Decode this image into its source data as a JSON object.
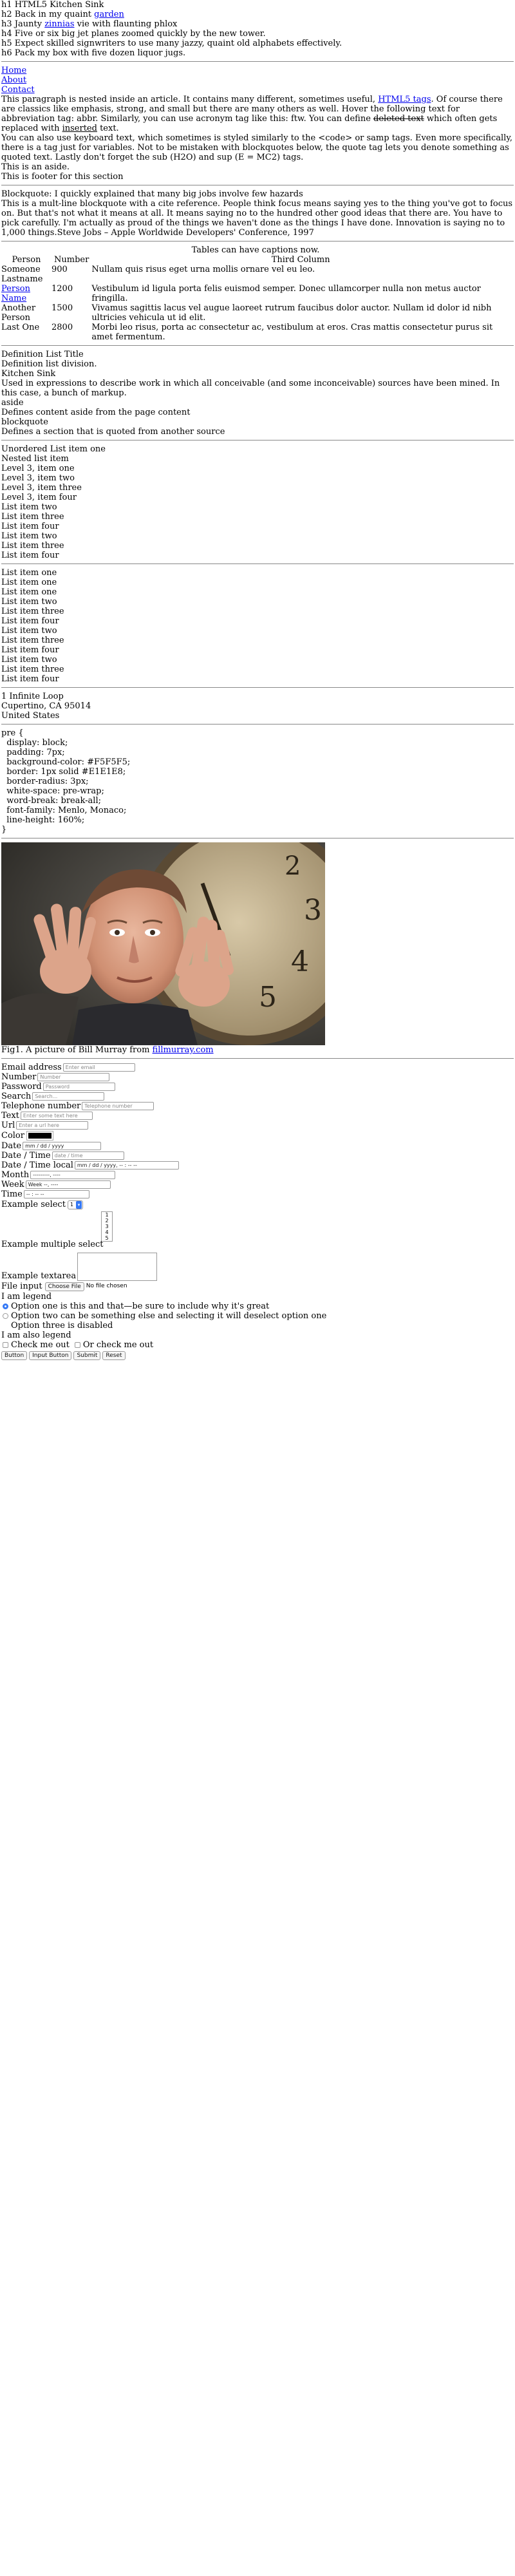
{
  "headings": {
    "h1": "h1 HTML5 Kitchen Sink",
    "h2_pre": "h2 Back in my quaint ",
    "h2_link": "garden",
    "h3_pre": "h3 Jaunty ",
    "h3_link": "zinnias",
    "h3_post": " vie with flaunting phlox",
    "h4": "h4 Five or six big jet planes zoomed quickly by the new tower.",
    "h5": "h5 Expect skilled signwriters to use many jazzy, quaint old alphabets effectively.",
    "h6": "h6 Pack my box with five dozen liquor jugs."
  },
  "nav": {
    "items": [
      "Home",
      "About",
      "Contact"
    ]
  },
  "article": {
    "p1_a": "This paragraph is nested inside an article. It contains many different, sometimes useful, ",
    "p1_link": "HTML5 tags",
    "p1_b": ". Of course there are classics like emphasis, strong, and small but there are many others as well. Hover the following text for abbreviation tag: abbr. Similarly, you can use acronym tag like this: ftw. You can define ",
    "p1_del": "deleted text",
    "p1_c": " which often gets replaced with ",
    "p1_ins": "inserted",
    "p1_d": " text.",
    "p2": "You can also use keyboard text, which sometimes is styled similarly to the <code> or samp tags. Even more specifically, there is a tag just for variables. Not to be mistaken with blockquotes below, the quote tag lets you denote something as quoted text. Lastly don't forget the sub (H2O) and sup (E = MC2) tags.",
    "aside": "This is an aside.",
    "footer": "This is footer for this section"
  },
  "blockquote": {
    "heading": "Blockquote: I quickly explained that many big jobs involve few hazards",
    "text": "This is a mult-line blockquote with a cite reference. People think focus means saying yes to the thing you've got to focus on. But that's not what it means at all. It means saying no to the hundred other good ideas that there are. You have to pick carefully. I'm actually as proud of the things we haven't done as the things I have done. Innovation is saying no to 1,000 things.Steve Jobs – Apple Worldwide Developers' Conference, 1997"
  },
  "table": {
    "caption": "Tables can have captions now.",
    "headers": [
      "Person",
      "Number",
      "Third Column"
    ],
    "rows": [
      {
        "person": "Someone Lastname",
        "number": "900",
        "third": "Nullam quis risus eget urna mollis ornare vel eu leo."
      },
      {
        "person": "Person Name",
        "number": "1200",
        "third": "Vestibulum id ligula porta felis euismod semper. Donec ullamcorper nulla non metus auctor fringilla."
      },
      {
        "person": "Another Person",
        "number": "1500",
        "third": "Vivamus sagittis lacus vel augue laoreet rutrum faucibus dolor auctor. Nullam id dolor id nibh ultricies vehicula ut id elit."
      },
      {
        "person": "Last One",
        "number": "2800",
        "third": "Morbi leo risus, porta ac consectetur ac, vestibulum at eros. Cras mattis consectetur purus sit amet fermentum."
      }
    ]
  },
  "deflist": {
    "lines": [
      "Definition List Title",
      "Definition list division.",
      "Kitchen Sink",
      "Used in expressions to describe work in which all conceivable (and some inconceivable) sources have been mined. In this case, a bunch of markup.",
      "aside",
      "Defines content aside from the page content",
      "blockquote",
      "Defines a section that is quoted from another source"
    ]
  },
  "unordered": {
    "items": [
      "Unordered List item one",
      "Nested list item",
      "Level 3, item one",
      "Level 3, item two",
      "Level 3, item three",
      "Level 3, item four",
      "List item two",
      "List item three",
      "List item four",
      "List item two",
      "List item three",
      "List item four"
    ]
  },
  "ordered": {
    "items": [
      "List item one",
      "List item one",
      "List item one",
      "List item two",
      "List item three",
      "List item four",
      "List item two",
      "List item three",
      "List item four",
      "List item two",
      "List item three",
      "List item four"
    ]
  },
  "address": {
    "lines": [
      "1 Infinite Loop",
      "Cupertino, CA 95014",
      "United States"
    ]
  },
  "pre": {
    "text": "pre {\n  display: block;\n  padding: 7px;\n  background-color: #F5F5F5;\n  border: 1px solid #E1E1E8;\n  border-radius: 3px;\n  white-space: pre-wrap;\n  word-break: break-all;\n  font-family: Menlo, Monaco;\n  line-height: 160%;\n}"
  },
  "figure": {
    "caption_a": "Fig1. A picture of Bill Murray from ",
    "caption_link": "fillmurray.com"
  },
  "form": {
    "email_label": "Email address",
    "email_placeholder": "Enter email",
    "number_label": "Number",
    "number_placeholder": "Number",
    "password_label": "Password",
    "password_placeholder": "Password",
    "search_label": "Search",
    "search_placeholder": "Search...",
    "tel_label": "Telephone number",
    "tel_placeholder": "Telephone number",
    "text_label": "Text",
    "text_placeholder": "Enter some text here",
    "url_label": "Url",
    "url_placeholder": "Enter a url here",
    "color_label": "Color",
    "color_value": "#000000",
    "date_label": "Date",
    "date_value": "mm / dd / yyyy",
    "datetime_label": "Date / Time",
    "datetime_value": "date / time",
    "datetimelocal_label": "Date / Time local",
    "datetimelocal_value": "mm / dd / yyyy, -- : -- --",
    "month_label": "Month",
    "month_value": "---------, ----",
    "week_label": "Week",
    "week_value": "Week --, ----",
    "time_label": "Time",
    "time_value": "-- : -- --",
    "select_label": "Example select",
    "select_value": "1",
    "multiselect_label": "Example multiple select",
    "multiselect_options": [
      "1",
      "2",
      "3",
      "4",
      "5"
    ],
    "textarea_label": "Example textarea",
    "file_label": "File input",
    "file_button": "Choose File",
    "file_status": "No file chosen",
    "legend1": "I am legend",
    "radio1": "Option one is this and that—be sure to include why it's great",
    "radio2": "Option two can be something else and selecting it will deselect option one",
    "radio3": "Option three is disabled",
    "legend2": "I am also legend",
    "check1": "Check me out",
    "check2": "Or check me out",
    "buttons": [
      "Button",
      "Input Button",
      "Submit",
      "Reset"
    ]
  },
  "colors": {
    "link": "#0000ee",
    "radio_accent": "#3478f6",
    "rule": "#888888"
  }
}
